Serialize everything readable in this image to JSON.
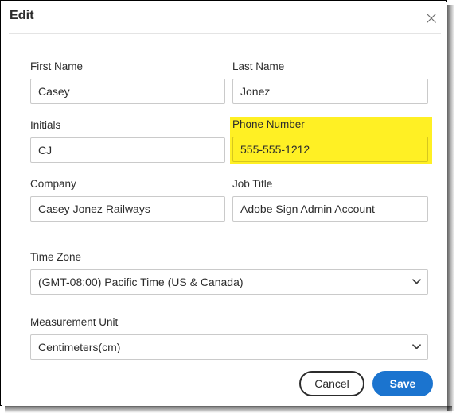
{
  "dialog": {
    "title": "Edit",
    "close_icon": "close-icon"
  },
  "fields": {
    "first_name": {
      "label": "First Name",
      "value": "Casey",
      "placeholder": ""
    },
    "last_name": {
      "label": "Last Name",
      "value": "Jonez",
      "placeholder": ""
    },
    "initials": {
      "label": "Initials",
      "value": "CJ",
      "placeholder": ""
    },
    "phone_number": {
      "label": "Phone Number",
      "value": "555-555-1212",
      "placeholder": "",
      "highlighted": true,
      "highlight_color": "#fff024"
    },
    "company": {
      "label": "Company",
      "value": "Casey Jonez Railways",
      "placeholder": ""
    },
    "job_title": {
      "label": "Job Title",
      "value": "Adobe Sign Admin Account",
      "placeholder": ""
    },
    "time_zone": {
      "label": "Time Zone",
      "value": "(GMT-08:00) Pacific Time (US & Canada)",
      "chevron_icon": "chevron-down-icon"
    },
    "measurement_unit": {
      "label": "Measurement Unit",
      "value": "Centimeters(cm)",
      "chevron_icon": "chevron-down-icon"
    }
  },
  "buttons": {
    "cancel": "Cancel",
    "save": "Save"
  },
  "colors": {
    "accent_blue": "#1b74cf",
    "highlight_yellow": "#fff024",
    "text": "#2c2c2c",
    "border": "#cacaca"
  }
}
